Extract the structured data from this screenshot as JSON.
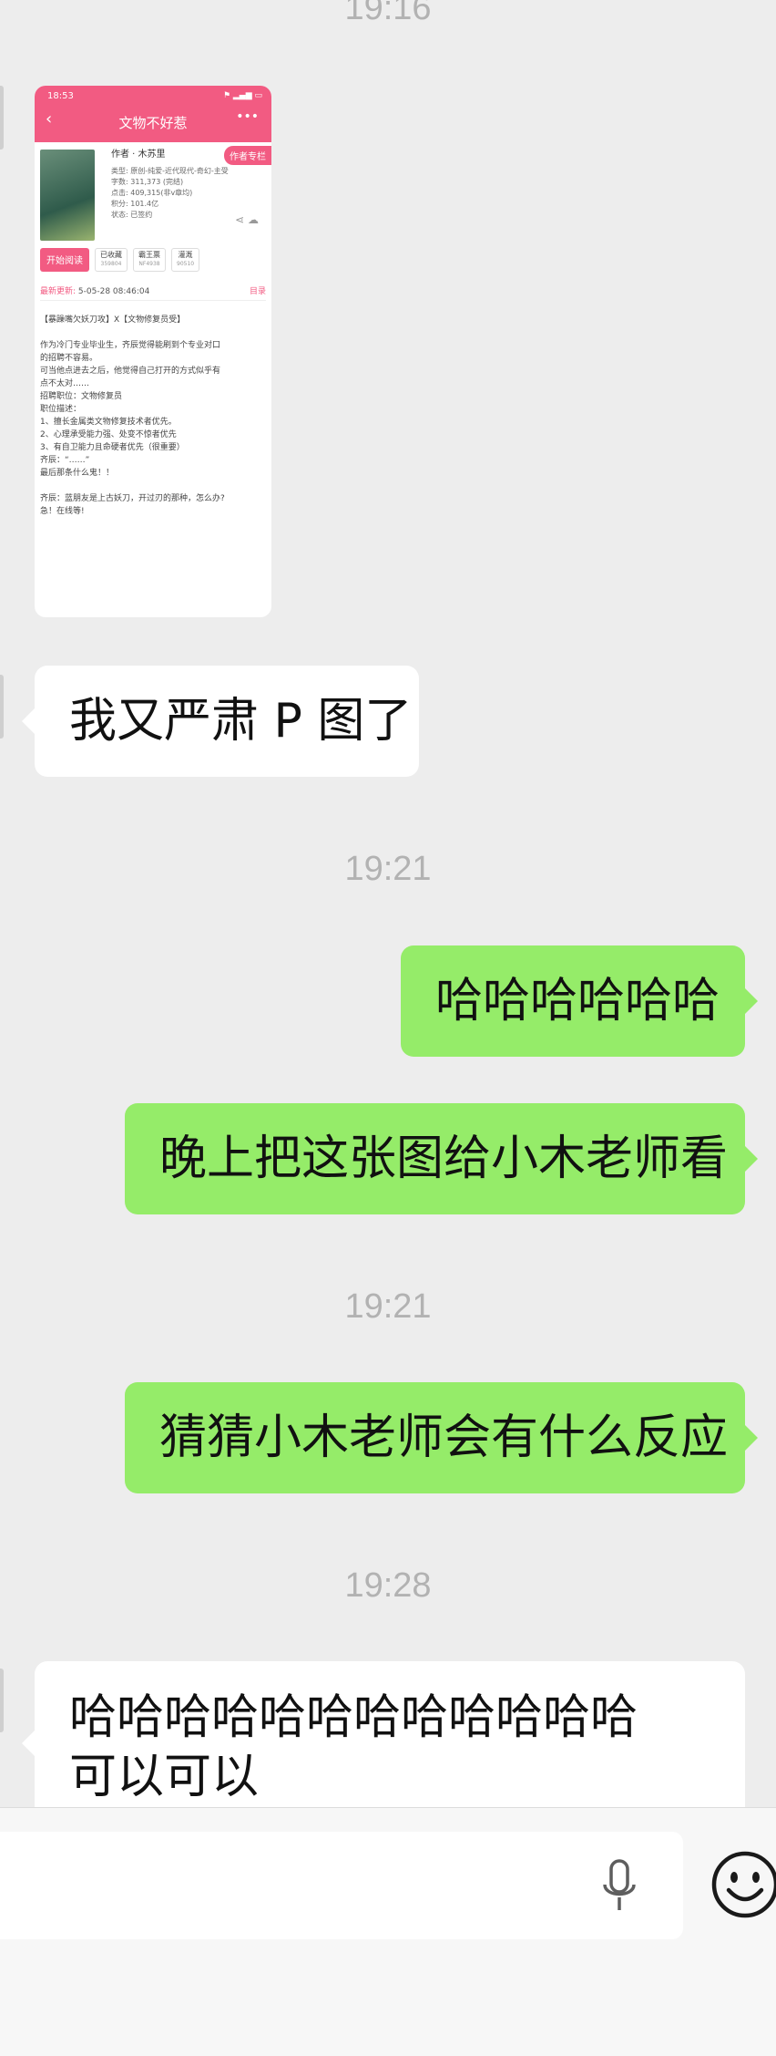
{
  "timestamps": [
    "19:16",
    "19:21",
    "19:21",
    "19:28"
  ],
  "shared_image": {
    "status_time": "18:53",
    "status_right": "⚑ ▂▄▆ ▭",
    "title": "文物不好惹",
    "author_tag": "作者专栏",
    "author": "作者 · 木苏里",
    "meta": [
      "类型: 原创-纯爱-近代现代-奇幻-主受",
      "字数: 311,373 (完结)",
      "点击: 409,315(非v章均)",
      "积分: 101.4亿",
      "状态: 已签约"
    ],
    "start_btn": "开始阅读",
    "buttons": [
      {
        "label": "已收藏",
        "count": "359804"
      },
      {
        "label": "霸王票",
        "count": "NF4938"
      },
      {
        "label": "灌溉",
        "count": "90510"
      }
    ],
    "update_label": "最新更新:",
    "update_time": "5-05-28 08:46:04",
    "toc": "目录",
    "description": [
      "【暴躁嘴欠妖刀攻】X【文物修复员受】",
      "",
      "作为冷门专业毕业生，齐辰觉得能刷到个专业对口",
      "的招聘不容易。",
      "可当他点进去之后，他觉得自己打开的方式似乎有",
      "点不太对……",
      "招聘职位：文物修复员",
      "职位描述：",
      "1、擅长金属类文物修复技术者优先。",
      "2、心理承受能力强、处变不惊者优先",
      "3、有自卫能力且命硬者优先（很重要）",
      "齐辰：“……”",
      "最后那条什么鬼！！",
      "",
      "齐辰：蓝朋友是上古妖刀，开过刃的那种，怎么办?",
      "急！在线等!"
    ]
  },
  "messages": {
    "m1": "我又严肃 P 图了",
    "m2": "哈哈哈哈哈哈",
    "m3": "晚上把这张图给小木老师看",
    "m4": "猜猜小木老师会有什么反应",
    "m5_line1": "哈哈哈哈哈哈哈哈哈哈哈哈",
    "m5_line2": "可以可以"
  },
  "icons": {
    "mic": "microphone-icon",
    "emoji": "smiley-emoji-icon"
  },
  "colors": {
    "background": "#ededed",
    "sent_bubble": "#95ec69",
    "received_bubble": "#ffffff",
    "timestamp": "#b2b2b2",
    "novel_app_pink": "#f25b82"
  }
}
